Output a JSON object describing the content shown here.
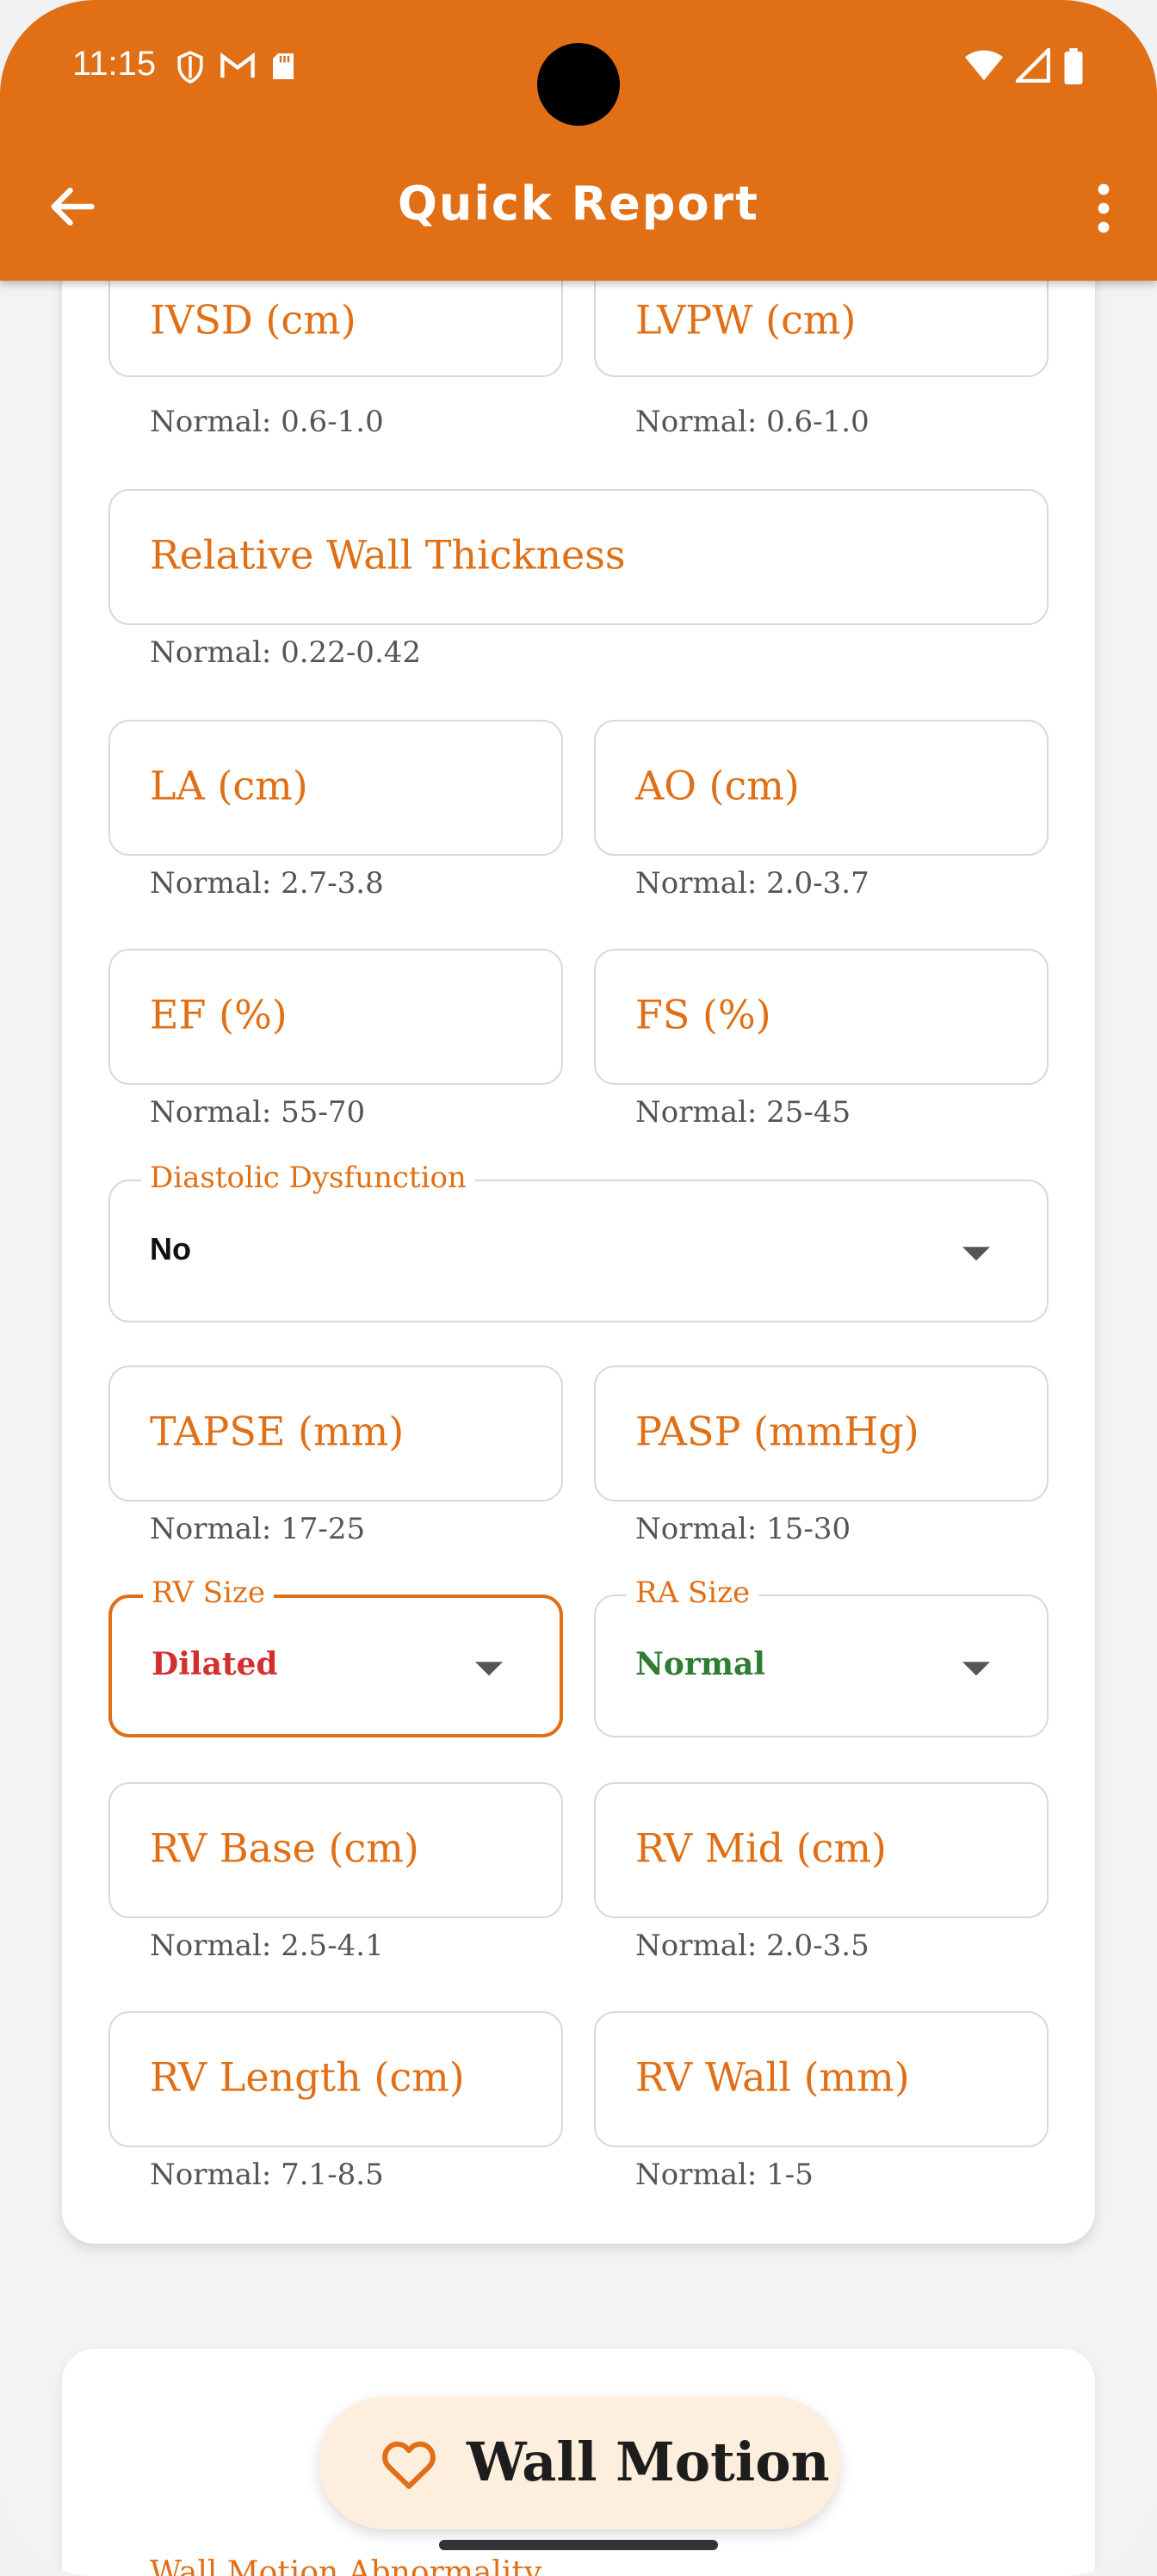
{
  "status_bar": {
    "time": "11:15"
  },
  "app_bar": {
    "title": "Quick Report"
  },
  "fields": {
    "ivsd": {
      "label": "IVSD (cm)",
      "hint": "Normal: 0.6-1.0"
    },
    "lvpw": {
      "label": "LVPW (cm)",
      "hint": "Normal: 0.6-1.0"
    },
    "rwt": {
      "label": "Relative Wall Thickness",
      "hint": "Normal: 0.22-0.42"
    },
    "la": {
      "label": "LA (cm)",
      "hint": "Normal: 2.7-3.8"
    },
    "ao": {
      "label": "AO (cm)",
      "hint": "Normal: 2.0-3.7"
    },
    "ef": {
      "label": "EF (%)",
      "hint": "Normal: 55-70"
    },
    "fs": {
      "label": "FS (%)",
      "hint": "Normal: 25-45"
    },
    "tapse": {
      "label": "TAPSE (mm)",
      "hint": "Normal: 17-25"
    },
    "pasp": {
      "label": "PASP (mmHg)",
      "hint": "Normal: 15-30"
    },
    "rv_base": {
      "label": "RV Base (cm)",
      "hint": "Normal: 2.5-4.1"
    },
    "rv_mid": {
      "label": "RV Mid (cm)",
      "hint": "Normal: 2.0-3.5"
    },
    "rv_length": {
      "label": "RV Length (cm)",
      "hint": "Normal: 7.1-8.5"
    },
    "rv_wall": {
      "label": "RV Wall (mm)",
      "hint": "Normal: 1-5"
    }
  },
  "dropdowns": {
    "diastolic": {
      "label": "Diastolic Dysfunction",
      "value": "No",
      "color": "#111111"
    },
    "rv_size": {
      "label": "RV Size",
      "value": "Dilated",
      "color": "#d32f2f"
    },
    "ra_size": {
      "label": "RA Size",
      "value": "Normal",
      "color": "#2e7d32"
    }
  },
  "wall_motion": {
    "button_label": "Wall Motion",
    "next_label": "Wall Motion Abnormality"
  },
  "colors": {
    "accent": "#e06f16",
    "button_bg": "#fdeedd"
  }
}
